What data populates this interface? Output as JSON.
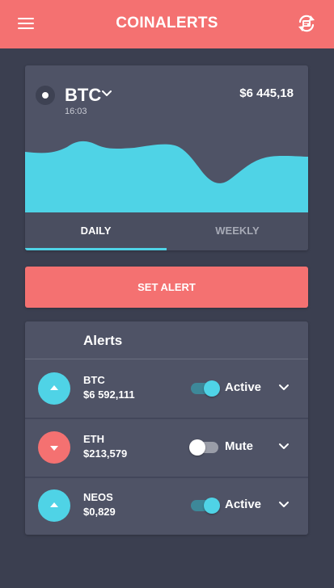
{
  "header": {
    "title": "COINALERTS",
    "menu_icon": "hamburger-menu-icon",
    "sync_icon": "refresh-sync-icon",
    "color": "#f47171"
  },
  "coin_card": {
    "name": "BTC",
    "time": "16:03",
    "price": "$6 445,18",
    "chart_color": "#4fd3e6",
    "tabs": [
      {
        "label": "DAILY",
        "active": true
      },
      {
        "label": "WEEKLY",
        "active": false
      }
    ]
  },
  "actions": {
    "set_alert_label": "SET ALERT"
  },
  "alerts": {
    "title": "Alerts",
    "items": [
      {
        "coin": "BTC",
        "value": "$6 592,111",
        "direction": "up",
        "status": "Active",
        "enabled": true
      },
      {
        "coin": "ETH",
        "value": "$213,579",
        "direction": "down",
        "status": "Mute",
        "enabled": false
      },
      {
        "coin": "NEOS",
        "value": "$0,829",
        "direction": "up",
        "status": "Active",
        "enabled": true
      }
    ]
  },
  "colors": {
    "accent_red": "#f47171",
    "accent_cyan": "#4fd3e6",
    "background": "#3b3f50",
    "card": "#4f5366"
  }
}
